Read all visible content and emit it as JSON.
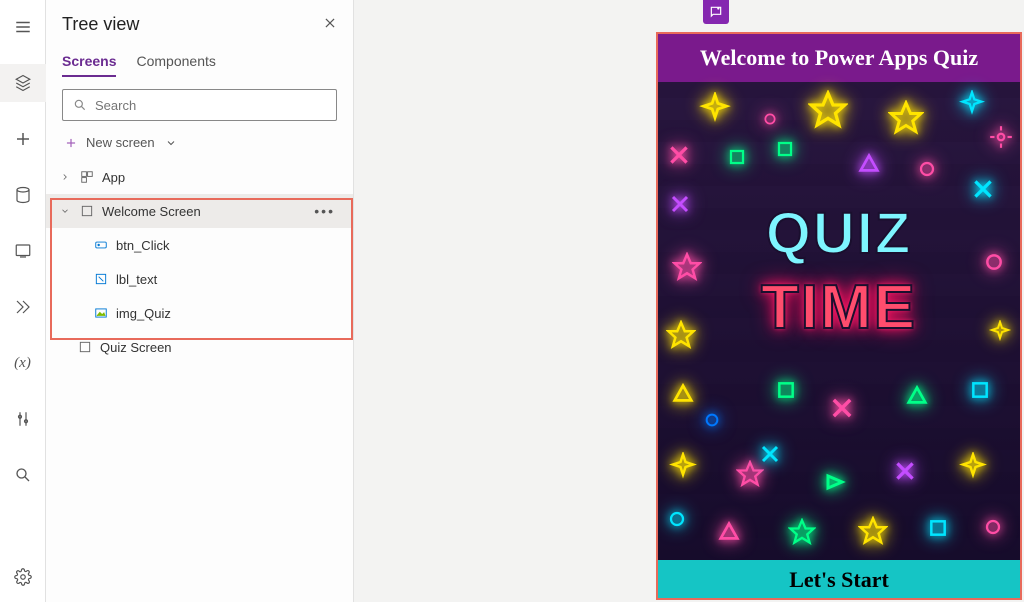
{
  "treeview": {
    "title": "Tree view",
    "tabs": {
      "screens": "Screens",
      "components": "Components"
    },
    "search_placeholder": "Search",
    "new_screen": "New screen",
    "items": {
      "app": "App",
      "welcome_screen": "Welcome Screen",
      "btn_click": "btn_Click",
      "lbl_text": "lbl_text",
      "img_quiz": "img_Quiz",
      "quiz_screen": "Quiz Screen"
    }
  },
  "preview": {
    "title": "Welcome to Power Apps Quiz",
    "quiz_word": "QUIZ",
    "time_word": "TIME",
    "start_button": "Let's Start"
  }
}
